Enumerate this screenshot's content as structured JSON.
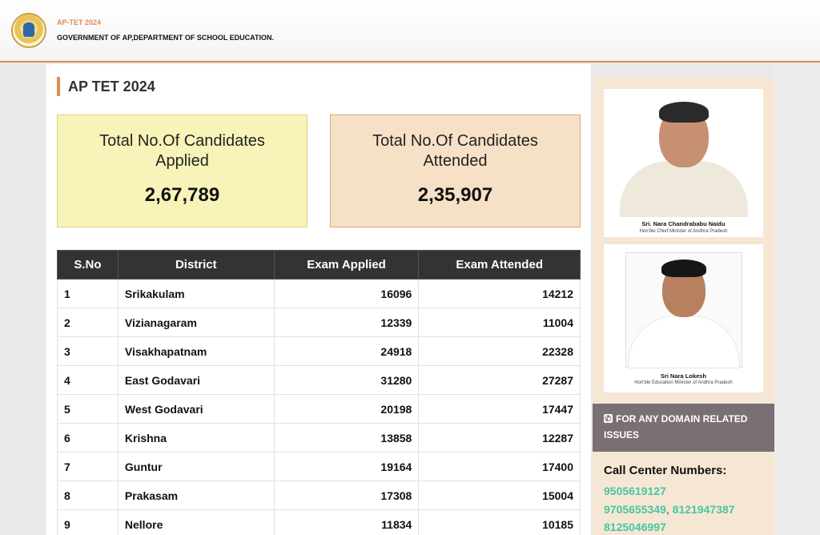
{
  "header": {
    "title": "AP-TET 2024",
    "subtitle": "GOVERNMENT OF AP,DEPARTMENT OF SCHOOL EDUCATION."
  },
  "page": {
    "title": "AP TET 2024"
  },
  "stats": {
    "applied_label": "Total No.Of Candidates Applied",
    "applied_value": "2,67,789",
    "attended_label": "Total No.Of Candidates Attended",
    "attended_value": "2,35,907"
  },
  "table": {
    "headers": [
      "S.No",
      "District",
      "Exam Applied",
      "Exam Attended"
    ],
    "rows": [
      [
        "1",
        "Srikakulam",
        "16096",
        "14212"
      ],
      [
        "2",
        "Vizianagaram",
        "12339",
        "11004"
      ],
      [
        "3",
        "Visakhapatnam",
        "24918",
        "22328"
      ],
      [
        "4",
        "East Godavari",
        "31280",
        "27287"
      ],
      [
        "5",
        "West Godavari",
        "20198",
        "17447"
      ],
      [
        "6",
        "Krishna",
        "13858",
        "12287"
      ],
      [
        "7",
        "Guntur",
        "19164",
        "17400"
      ],
      [
        "8",
        "Prakasam",
        "17308",
        "15004"
      ],
      [
        "9",
        "Nellore",
        "11834",
        "10185"
      ]
    ]
  },
  "sidebar": {
    "cm_name": "Sri. Nara Chandrababu Naidu",
    "cm_role": "Hon'ble Chief Minister of Andhra Pradesh",
    "minister_name": "Sri Nara Lokesh",
    "minister_role": "Hon'ble Education Minister of Andhra Pradesh",
    "domain_text": "FOR ANY DOMAIN RELATED ISSUES",
    "call_title": "Call Center Numbers:",
    "phones": [
      "9505619127",
      "9705655349",
      "8121947387",
      "8125046997"
    ]
  }
}
